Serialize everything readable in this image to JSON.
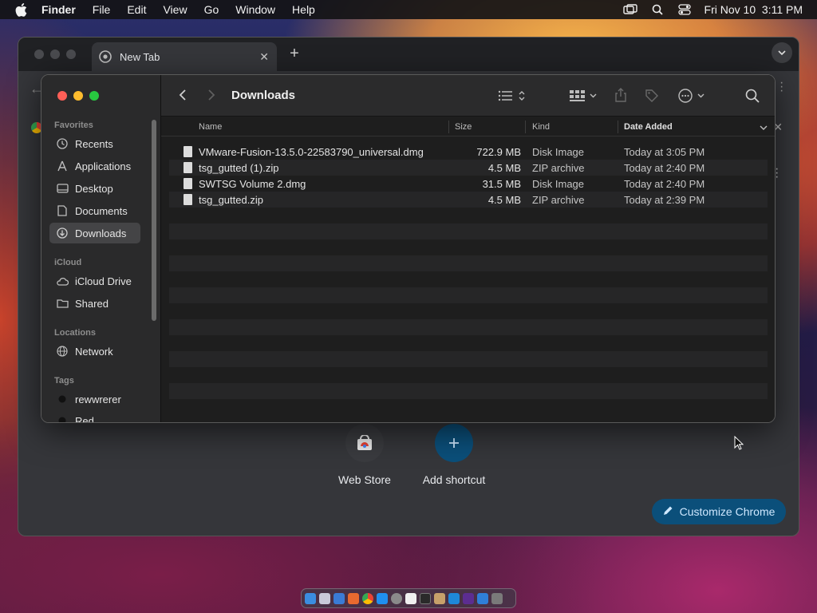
{
  "menubar": {
    "app": "Finder",
    "items": [
      "File",
      "Edit",
      "View",
      "Go",
      "Window",
      "Help"
    ],
    "datetime": "Fri Nov 10  3:11 PM"
  },
  "chrome": {
    "tab_title": "New Tab",
    "shortcuts": [
      {
        "label": "Web Store"
      },
      {
        "label": "Add shortcut"
      }
    ],
    "customize_label": "Customize Chrome"
  },
  "finder": {
    "title": "Downloads",
    "sidebar": {
      "favorites_label": "Favorites",
      "favorites": [
        "Recents",
        "Applications",
        "Desktop",
        "Documents",
        "Downloads"
      ],
      "icloud_label": "iCloud",
      "icloud": [
        "iCloud Drive",
        "Shared"
      ],
      "locations_label": "Locations",
      "locations": [
        "Network"
      ],
      "tags_label": "Tags",
      "tags": [
        "rewwrerer",
        "Red"
      ]
    },
    "columns": {
      "name": "Name",
      "size": "Size",
      "kind": "Kind",
      "date": "Date Added"
    },
    "files": [
      {
        "name": "VMware-Fusion-13.5.0-22583790_universal.dmg",
        "size": "722.9 MB",
        "kind": "Disk Image",
        "date": "Today at 3:05 PM"
      },
      {
        "name": "tsg_gutted (1).zip",
        "size": "4.5 MB",
        "kind": "ZIP archive",
        "date": "Today at 2:40 PM"
      },
      {
        "name": "SWTSG Volume 2.dmg",
        "size": "31.5 MB",
        "kind": "Disk Image",
        "date": "Today at 2:40 PM"
      },
      {
        "name": "tsg_gutted.zip",
        "size": "4.5 MB",
        "kind": "ZIP archive",
        "date": "Today at 2:39 PM"
      }
    ]
  },
  "colors": {
    "accent_red": "#ff5f57",
    "accent_yellow": "#febc2e",
    "accent_green": "#28c840",
    "customize_bg": "#0b4f7a"
  }
}
